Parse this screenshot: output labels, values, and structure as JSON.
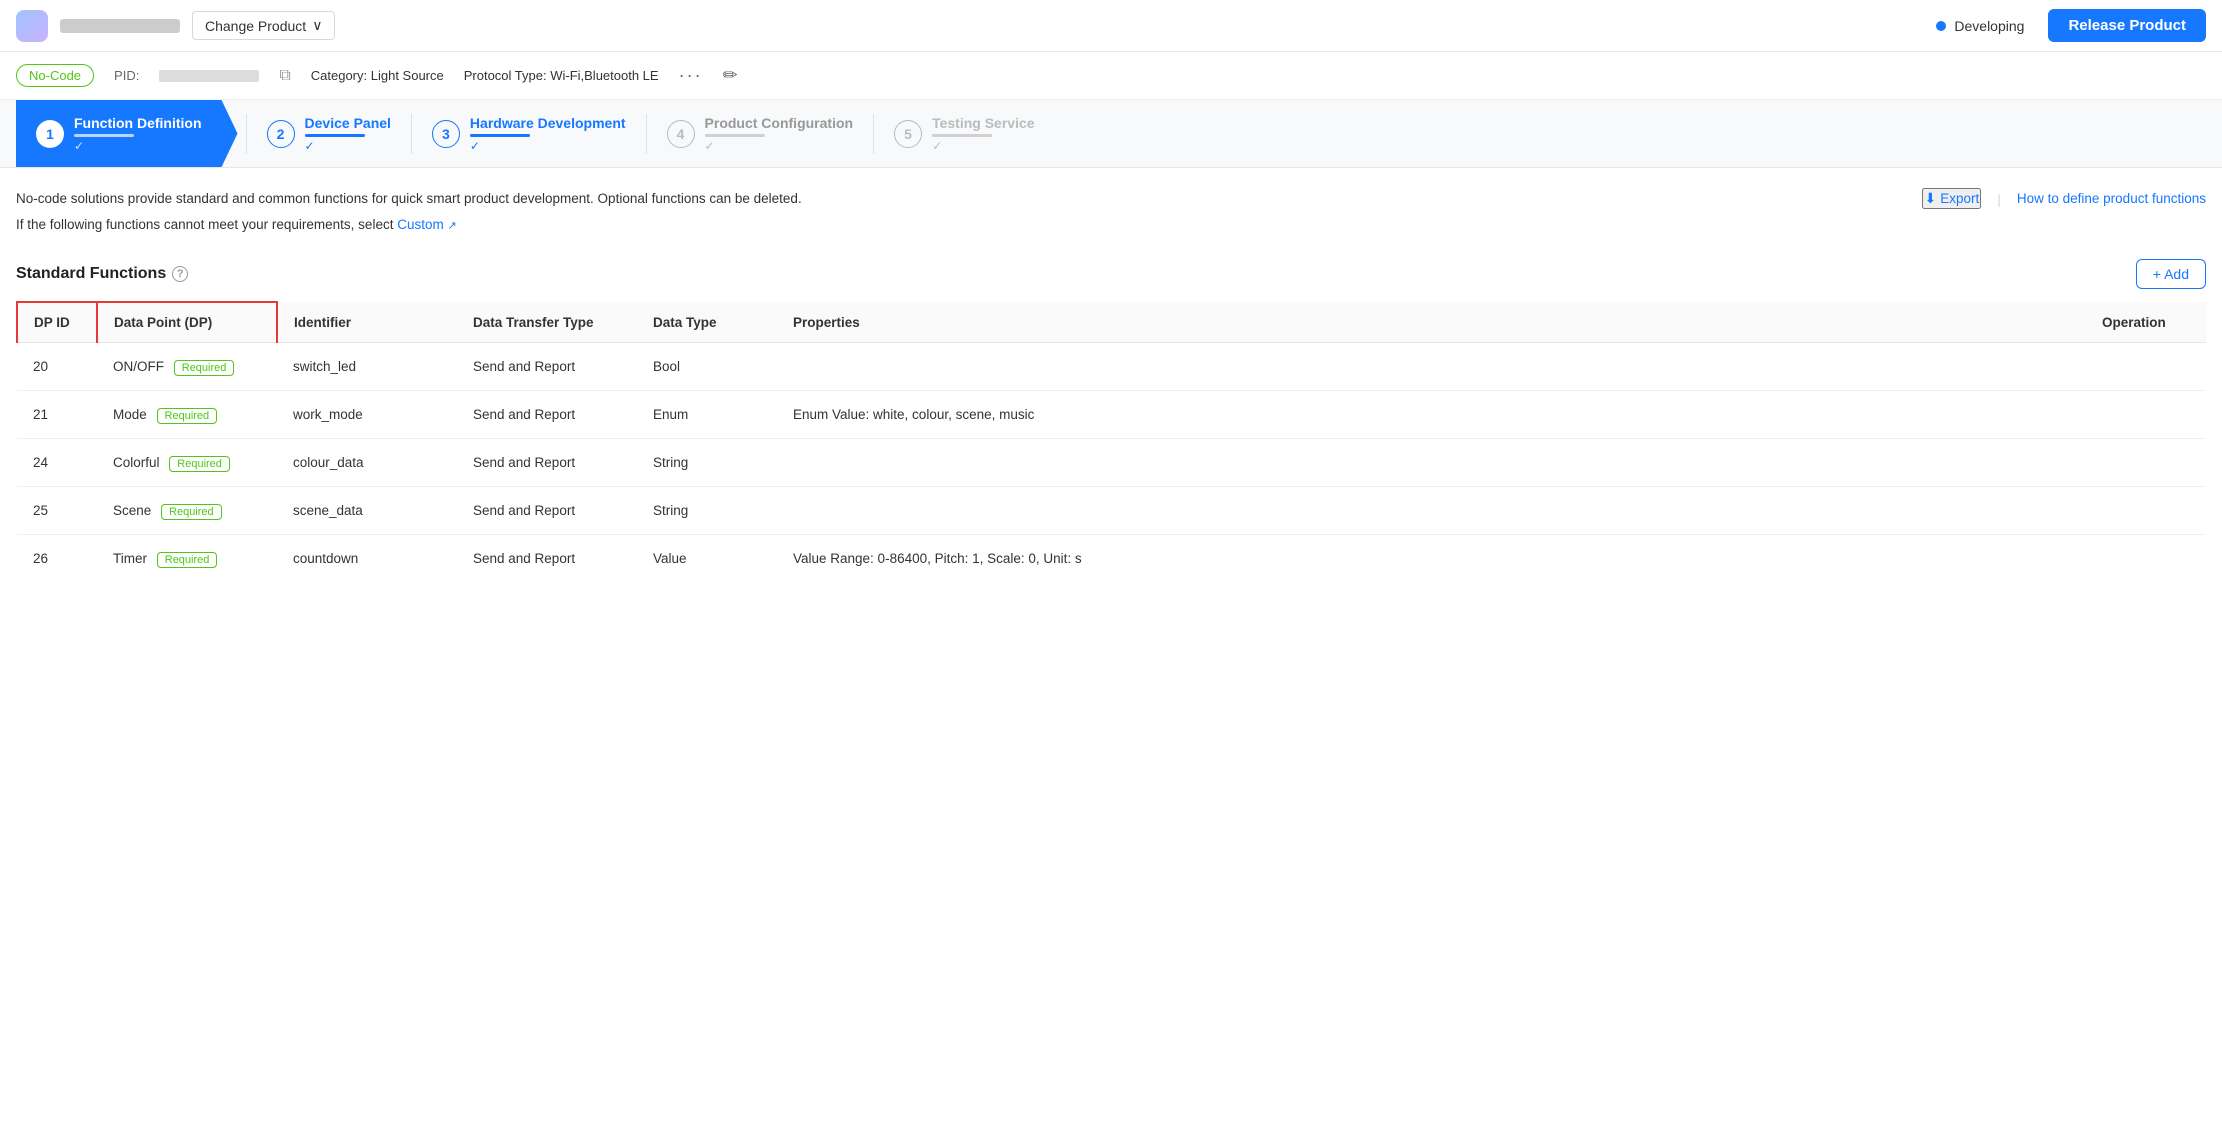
{
  "header": {
    "change_product_label": "Change Product",
    "chevron": "∨",
    "developing_label": "Developing",
    "release_btn_label": "Release Product"
  },
  "sub_header": {
    "no_code_label": "No-Code",
    "pid_label": "PID:",
    "category_label": "Category: Light Source",
    "protocol_label": "Protocol Type: Wi-Fi,Bluetooth LE"
  },
  "steps": [
    {
      "number": "1",
      "title": "Function Definition",
      "state": "active"
    },
    {
      "number": "2",
      "title": "Device Panel",
      "state": "blue"
    },
    {
      "number": "3",
      "title": "Hardware Development",
      "state": "blue"
    },
    {
      "number": "4",
      "title": "Product Configuration",
      "state": "light"
    },
    {
      "number": "5",
      "title": "Testing Service",
      "state": "gray"
    }
  ],
  "description": {
    "line1": "No-code solutions provide standard and common functions for quick smart product development. Optional functions can be deleted.",
    "line2_prefix": "If the following functions cannot meet your requirements, select ",
    "custom_label": "Custom",
    "export_label": "Export",
    "help_label": "How to define product functions"
  },
  "table": {
    "section_title": "Standard Functions",
    "add_btn_label": "+ Add",
    "headers": {
      "dpid": "DP ID",
      "dp": "Data Point (DP)",
      "identifier": "Identifier",
      "transfer": "Data Transfer Type",
      "type": "Data Type",
      "properties": "Properties",
      "operation": "Operation"
    },
    "rows": [
      {
        "dpid": "20",
        "dp": "ON/OFF",
        "required": true,
        "identifier": "switch_led",
        "transfer": "Send and Report",
        "type": "Bool",
        "properties": ""
      },
      {
        "dpid": "21",
        "dp": "Mode",
        "required": true,
        "identifier": "work_mode",
        "transfer": "Send and Report",
        "type": "Enum",
        "properties": "Enum Value: white, colour, scene, music"
      },
      {
        "dpid": "24",
        "dp": "Colorful",
        "required": true,
        "identifier": "colour_data",
        "transfer": "Send and Report",
        "type": "String",
        "properties": ""
      },
      {
        "dpid": "25",
        "dp": "Scene",
        "required": true,
        "identifier": "scene_data",
        "transfer": "Send and Report",
        "type": "String",
        "properties": ""
      },
      {
        "dpid": "26",
        "dp": "Timer",
        "required": true,
        "identifier": "countdown",
        "transfer": "Send and Report",
        "type": "Value",
        "properties": "Value Range: 0-86400, Pitch: 1, Scale: 0, Unit: s"
      }
    ]
  }
}
